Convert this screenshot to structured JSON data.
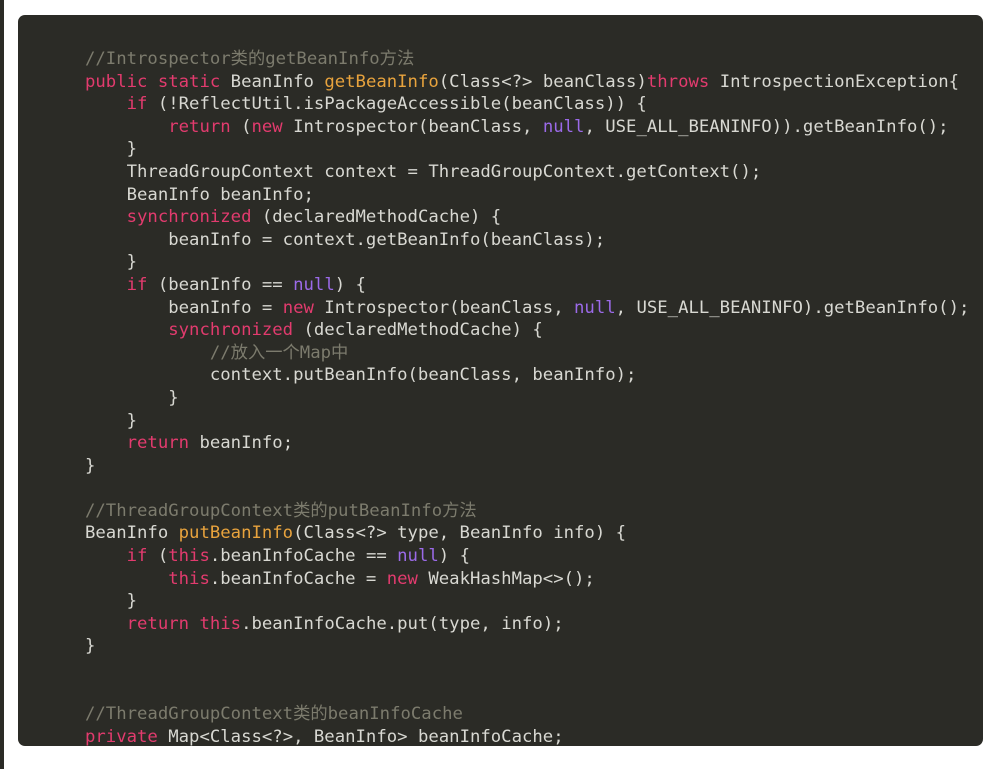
{
  "page": {
    "kind": "code-snippet-screenshot",
    "background_color": "#ffffff"
  },
  "code_block": {
    "background_color": "#2b2b26",
    "default_text_color": "#d8d8d2",
    "language": "java",
    "palette": {
      "comment": "#7c7b6d",
      "keyword": "#e23b6e",
      "function": "#e8a33d",
      "null_literal": "#9b6ae8",
      "plain": "#d8d8d2"
    },
    "lines": [
      [
        {
          "t": "//Introspector类的getBeanInfo方法",
          "c": "cm"
        }
      ],
      [
        {
          "t": "public",
          "c": "kw"
        },
        {
          "t": " ",
          "c": "pl"
        },
        {
          "t": "static",
          "c": "kw"
        },
        {
          "t": " BeanInfo ",
          "c": "pl"
        },
        {
          "t": "getBeanInfo",
          "c": "fn"
        },
        {
          "t": "(Class<?> beanClass)",
          "c": "pl"
        },
        {
          "t": "throws",
          "c": "kw"
        },
        {
          "t": " IntrospectionException{",
          "c": "pl"
        }
      ],
      [
        {
          "t": "    ",
          "c": "pl"
        },
        {
          "t": "if",
          "c": "kw"
        },
        {
          "t": " (!ReflectUtil.isPackageAccessible(beanClass)) {",
          "c": "pl"
        }
      ],
      [
        {
          "t": "        ",
          "c": "pl"
        },
        {
          "t": "return",
          "c": "kw"
        },
        {
          "t": " (",
          "c": "pl"
        },
        {
          "t": "new",
          "c": "kw"
        },
        {
          "t": " Introspector(beanClass, ",
          "c": "pl"
        },
        {
          "t": "null",
          "c": "nul"
        },
        {
          "t": ", USE_ALL_BEANINFO)).getBeanInfo();",
          "c": "pl"
        }
      ],
      [
        {
          "t": "    }",
          "c": "pl"
        }
      ],
      [
        {
          "t": "    ThreadGroupContext context = ThreadGroupContext.getContext();",
          "c": "pl"
        }
      ],
      [
        {
          "t": "    BeanInfo beanInfo;",
          "c": "pl"
        }
      ],
      [
        {
          "t": "    ",
          "c": "pl"
        },
        {
          "t": "synchronized",
          "c": "kw"
        },
        {
          "t": " (declaredMethodCache) {",
          "c": "pl"
        }
      ],
      [
        {
          "t": "        beanInfo = context.getBeanInfo(beanClass);",
          "c": "pl"
        }
      ],
      [
        {
          "t": "    }",
          "c": "pl"
        }
      ],
      [
        {
          "t": "    ",
          "c": "pl"
        },
        {
          "t": "if",
          "c": "kw"
        },
        {
          "t": " (beanInfo == ",
          "c": "pl"
        },
        {
          "t": "null",
          "c": "nul"
        },
        {
          "t": ") {",
          "c": "pl"
        }
      ],
      [
        {
          "t": "        beanInfo = ",
          "c": "pl"
        },
        {
          "t": "new",
          "c": "kw"
        },
        {
          "t": " Introspector(beanClass, ",
          "c": "pl"
        },
        {
          "t": "null",
          "c": "nul"
        },
        {
          "t": ", USE_ALL_BEANINFO).getBeanInfo();",
          "c": "pl"
        }
      ],
      [
        {
          "t": "        ",
          "c": "pl"
        },
        {
          "t": "synchronized",
          "c": "kw"
        },
        {
          "t": " (declaredMethodCache) {",
          "c": "pl"
        }
      ],
      [
        {
          "t": "            ",
          "c": "pl"
        },
        {
          "t": "//放入一个Map中",
          "c": "cm"
        }
      ],
      [
        {
          "t": "            context.putBeanInfo(beanClass, beanInfo);",
          "c": "pl"
        }
      ],
      [
        {
          "t": "        }",
          "c": "pl"
        }
      ],
      [
        {
          "t": "    }",
          "c": "pl"
        }
      ],
      [
        {
          "t": "    ",
          "c": "pl"
        },
        {
          "t": "return",
          "c": "kw"
        },
        {
          "t": " beanInfo;",
          "c": "pl"
        }
      ],
      [
        {
          "t": "}",
          "c": "pl"
        }
      ],
      [
        {
          "t": "",
          "c": "pl"
        }
      ],
      [
        {
          "t": "//ThreadGroupContext类的putBeanInfo方法",
          "c": "cm"
        }
      ],
      [
        {
          "t": "BeanInfo ",
          "c": "pl"
        },
        {
          "t": "putBeanInfo",
          "c": "fn"
        },
        {
          "t": "(Class<?> type, BeanInfo info) {",
          "c": "pl"
        }
      ],
      [
        {
          "t": "    ",
          "c": "pl"
        },
        {
          "t": "if",
          "c": "kw"
        },
        {
          "t": " (",
          "c": "pl"
        },
        {
          "t": "this",
          "c": "kw"
        },
        {
          "t": ".beanInfoCache == ",
          "c": "pl"
        },
        {
          "t": "null",
          "c": "nul"
        },
        {
          "t": ") {",
          "c": "pl"
        }
      ],
      [
        {
          "t": "        ",
          "c": "pl"
        },
        {
          "t": "this",
          "c": "kw"
        },
        {
          "t": ".beanInfoCache = ",
          "c": "pl"
        },
        {
          "t": "new",
          "c": "kw"
        },
        {
          "t": " WeakHashMap<>();",
          "c": "pl"
        }
      ],
      [
        {
          "t": "    }",
          "c": "pl"
        }
      ],
      [
        {
          "t": "    ",
          "c": "pl"
        },
        {
          "t": "return",
          "c": "kw"
        },
        {
          "t": " ",
          "c": "pl"
        },
        {
          "t": "this",
          "c": "kw"
        },
        {
          "t": ".beanInfoCache.put(type, info);",
          "c": "pl"
        }
      ],
      [
        {
          "t": "}",
          "c": "pl"
        }
      ],
      [
        {
          "t": "",
          "c": "pl"
        }
      ],
      [
        {
          "t": "",
          "c": "pl"
        }
      ],
      [
        {
          "t": "//ThreadGroupContext类的beanInfoCache",
          "c": "cm"
        }
      ],
      [
        {
          "t": "private",
          "c": "kw"
        },
        {
          "t": " Map<Class<?>, BeanInfo> beanInfoCache;",
          "c": "pl"
        }
      ]
    ]
  }
}
